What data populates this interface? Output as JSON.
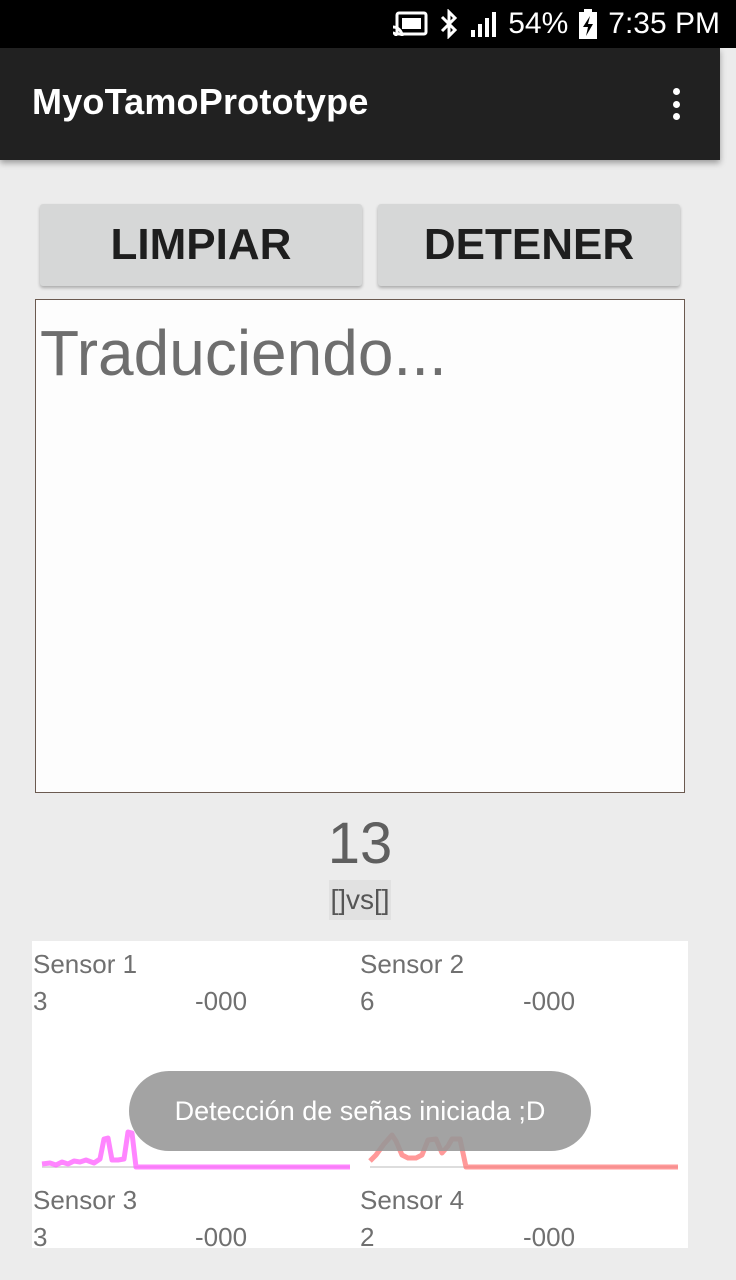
{
  "status_bar": {
    "battery": "54%",
    "time": "7:35 PM",
    "icons": [
      "cast-icon",
      "bluetooth-icon",
      "signal-icon",
      "battery-charging-icon"
    ]
  },
  "app_bar": {
    "title": "MyoTamoPrototype",
    "menu_icon": "overflow-menu-icon"
  },
  "buttons": {
    "clear": "LIMPIAR",
    "stop": "DETENER"
  },
  "output": {
    "text": "Traduciendo..."
  },
  "counter": "13",
  "comparison": "[]vs[]",
  "sensors": [
    {
      "label": "Sensor 1",
      "value": "3",
      "reading": "-000",
      "color": "#ff66ff"
    },
    {
      "label": "Sensor 2",
      "value": "6",
      "reading": "-000",
      "color": "#ff7f7f"
    },
    {
      "label": "Sensor 3",
      "value": "3",
      "reading": "-000"
    },
    {
      "label": "Sensor 4",
      "value": "2",
      "reading": "-000"
    }
  ],
  "toast": "Detección de señas iniciada ;D"
}
